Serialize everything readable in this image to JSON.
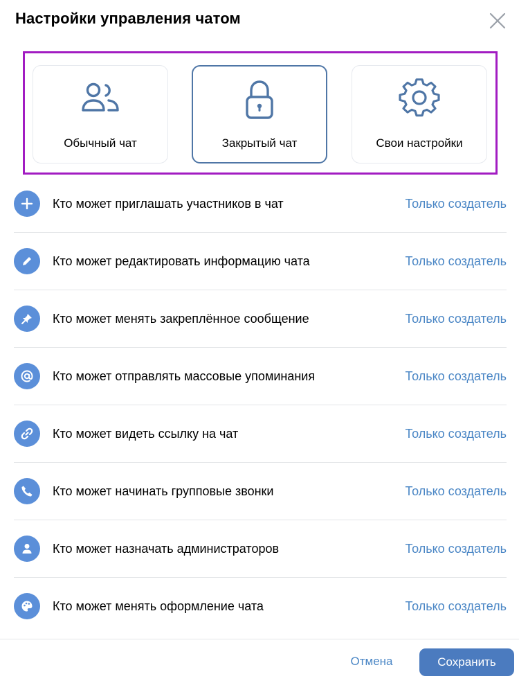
{
  "dialog": {
    "title": "Настройки управления чатом"
  },
  "modes": [
    {
      "label": "Обычный чат",
      "icon": "users-icon",
      "selected": false
    },
    {
      "label": "Закрытый чат",
      "icon": "lock-icon",
      "selected": true
    },
    {
      "label": "Свои настройки",
      "icon": "gear-icon",
      "selected": false
    }
  ],
  "settings": [
    {
      "label": "Кто может приглашать участников в чат",
      "value": "Только создатель",
      "icon": "plus-icon"
    },
    {
      "label": "Кто может редактировать информацию чата",
      "value": "Только создатель",
      "icon": "pencil-icon"
    },
    {
      "label": "Кто может менять закреплённое сообщение",
      "value": "Только создатель",
      "icon": "pin-icon"
    },
    {
      "label": "Кто может отправлять массовые упоминания",
      "value": "Только создатель",
      "icon": "at-icon"
    },
    {
      "label": "Кто может видеть ссылку на чат",
      "value": "Только создатель",
      "icon": "link-icon"
    },
    {
      "label": "Кто может начинать групповые звонки",
      "value": "Только создатель",
      "icon": "phone-icon"
    },
    {
      "label": "Кто может назначать администраторов",
      "value": "Только создатель",
      "icon": "person-icon"
    },
    {
      "label": "Кто может менять оформление чата",
      "value": "Только создатель",
      "icon": "palette-icon"
    }
  ],
  "footer": {
    "cancel_label": "Отмена",
    "save_label": "Сохранить"
  },
  "colors": {
    "accent": "#4b7bbf",
    "link": "#4a86c5",
    "icon_bg": "#5b8fd9",
    "highlight_frame": "#a21cc2"
  }
}
